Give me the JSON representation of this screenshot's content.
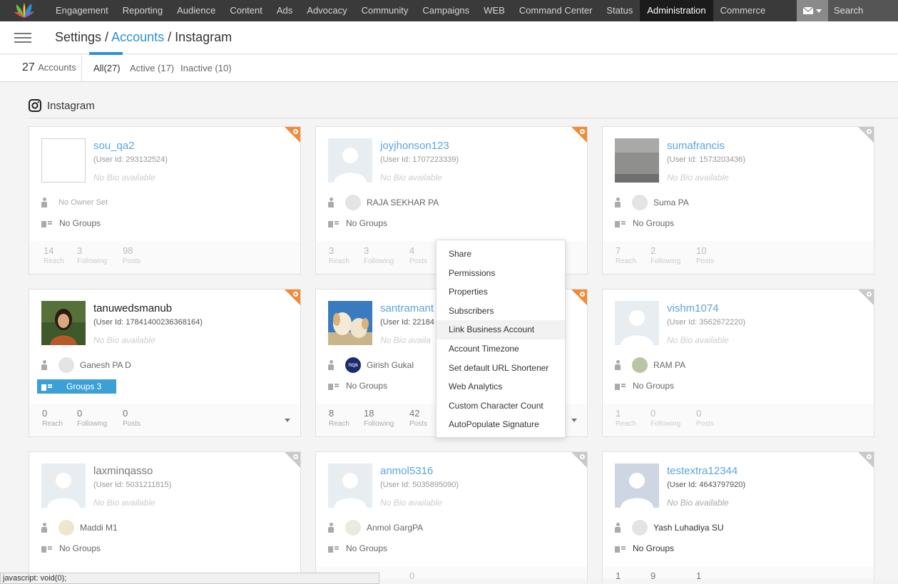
{
  "nav": {
    "items": [
      "Engagement",
      "Reporting",
      "Audience",
      "Content",
      "Ads",
      "Advocacy",
      "Community",
      "Campaigns",
      "WEB",
      "Command Center",
      "Status",
      "Administration",
      "Commerce"
    ],
    "active": "Administration",
    "search_label": "Search",
    "mail_icon": "mail-icon"
  },
  "breadcrumb": {
    "settings": "Settings",
    "sep1": " / ",
    "accounts": "Accounts",
    "sep2": " / ",
    "current": "Instagram"
  },
  "summary": {
    "count": "27",
    "label": "Accounts"
  },
  "tabs": [
    {
      "label": "All(27)",
      "active": true
    },
    {
      "label": "Active (17)",
      "active": false
    },
    {
      "label": "Inactive (10)",
      "active": false
    }
  ],
  "section_title": "Instagram",
  "cards": [
    {
      "name": "sou_qa2",
      "user_id": "(User Id: 293132524)",
      "bio": "No Bio available",
      "owner": "No Owner Set",
      "groups": "No Groups",
      "reach": "14",
      "following": "3",
      "posts": "98",
      "reach_label": "Reach",
      "following_label": "Following",
      "posts_label": "Posts"
    },
    {
      "name": "joyjhonson123",
      "user_id": "(User Id: 1707223339)",
      "bio": "No Bio available",
      "owner": "RAJA SEKHAR PA",
      "groups": "No Groups",
      "reach": "3",
      "following": "3",
      "posts": "4",
      "reach_label": "Reach",
      "following_label": "Following",
      "posts_label": "Posts"
    },
    {
      "name": "sumafrancis",
      "user_id": "(User Id: 1573203436)",
      "bio": "No Bio available",
      "owner": "Suma PA",
      "groups": "No Groups",
      "reach": "7",
      "following": "2",
      "posts": "10",
      "reach_label": "Reach",
      "following_label": "Following",
      "posts_label": "Posts"
    },
    {
      "name": "tanuwedsmanub",
      "user_id": "(User Id: 17841400236368164)",
      "bio": "No Bio available",
      "owner": "Ganesh PA D",
      "groups": "Groups 3",
      "reach": "0",
      "following": "0",
      "posts": "0",
      "reach_label": "Reach",
      "following_label": "Following",
      "posts_label": "Posts"
    },
    {
      "name": "santramant",
      "user_id": "(User Id: 22184",
      "bio": "No Bio availa",
      "owner": "Girish Gukal",
      "owner_initials": "nqa",
      "groups": "No Groups",
      "reach": "8",
      "following": "18",
      "posts": "42",
      "reach_label": "Reach",
      "following_label": "Following",
      "posts_label": "Posts"
    },
    {
      "name": "vishm1074",
      "user_id": "(User Id: 3562672220)",
      "bio": "No Bio available",
      "owner": "RAM PA",
      "groups": "No Groups",
      "reach": "1",
      "following": "0",
      "posts": "0",
      "reach_label": "Reach",
      "following_label": "Following",
      "posts_label": "Posts"
    },
    {
      "name": "laxminqasso",
      "user_id": "(User Id: 5031211815)",
      "bio": "No Bio available",
      "owner": "Maddi M1",
      "groups": "No Groups"
    },
    {
      "name": "anmol5316",
      "user_id": "(User Id: 5035895090)",
      "bio": "No Bio available",
      "owner": "Anmol GargPA",
      "groups": "No Groups",
      "posts": "0"
    },
    {
      "name": "testextra12344",
      "user_id": "(User Id: 4643797920)",
      "bio": "No Bio available",
      "owner": "Yash Luhadiya SU",
      "groups": "No Groups",
      "reach": "1",
      "following": "9",
      "posts": "1"
    }
  ],
  "dropdown": [
    "Share",
    "Permissions",
    "Properties",
    "Subscribers",
    "Link Business Account",
    "Account Timezone",
    "Set default URL Shortener",
    "Web Analytics",
    "Custom Character Count",
    "AutoPopulate Signature"
  ],
  "status_url": "javascript: void(0);",
  "colors": {
    "accent": "#2d8fd5",
    "nav_bg": "#3a3a3a",
    "corner_active": "#f08b3a",
    "corner_inactive": "#c9c9c9",
    "group_pill": "#3c9fd6"
  }
}
